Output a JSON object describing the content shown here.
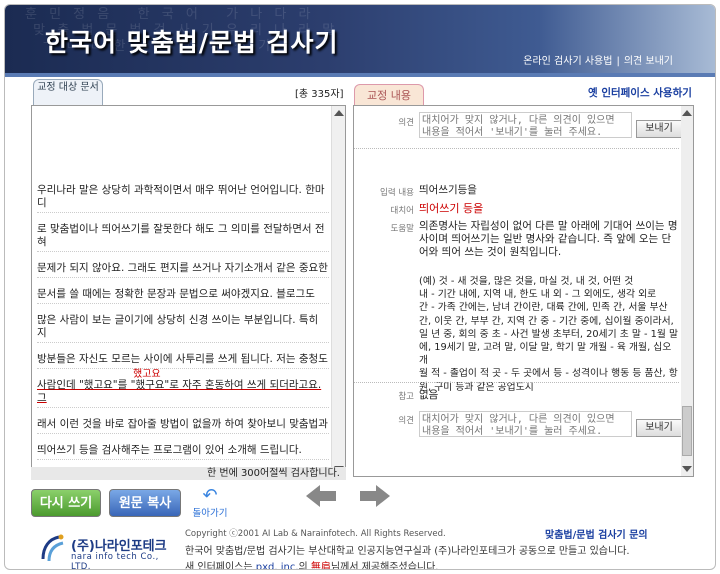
{
  "header": {
    "title": "한국어 맞춤법/문법 검사기",
    "background_text": "훈 민 정 음   한 국 어   가 나 다 라\n 맞 춤 법 문 법 검 사 기 우 리 나 라 말\n  ㄱ ㄴ ㄷ 한 글 바 르 게 쓰 기",
    "link_manual": "온라인 검사기 사용법",
    "link_separator": "|",
    "link_feedback": "의견 보내기"
  },
  "left": {
    "tab_label": "교정 대상 문서",
    "char_count": "[총 335자]",
    "paragraphs": [
      "우리나라 말은 상당히 과학적이면서 매우 뛰어난 언어입니다. 한마디",
      "로 맞춤법이나 띄어쓰기를 잘못한다 해도 그 의미를 전달하면서 전혀",
      "문제가 되지 않아요. 그래도 편지를 쓰거나 자기소개서 같은 중요한",
      "문서를 쓸 때에는 정확한 문장과 문법으로 써야겠지요. 블로그도",
      "많은 사람이 보는 글이기에 상당히 신경 쓰이는 부분입니다. 특히 지",
      "방분들은 자신도 모르는 사이에 사투리를 쓰게 됩니다. 저는 충청도",
      "사람인데 \"했고요\"를 \"했구요\"로 자주 혼동하여 쓰게 되더라고요. 그",
      "래서 이런 것을 바로 잡아줄 방법이 없을까 하여 찾아보니 맞춤법과",
      "띄어쓰기 등을 검사해주는 프로그램이 있어 소개해 드립니다."
    ],
    "suggestion_above": "했고요",
    "footer_text": "한 번에 300어절씩 검사합니다."
  },
  "right": {
    "tab_label": "교정 내용",
    "old_interface_link": "옛 인터페이스 사용하기",
    "opinion_label": "의견",
    "opinion_placeholder": "대치어가 맞지 않거나, 다른 의견이 있으면 내용을 적어서 '보내기'를 눌러 주세요.",
    "send_label": "보내기",
    "input_label": "입력 내용",
    "input_value": "띄어쓰기등을",
    "replace_label": "대치어",
    "replace_value": "띄어쓰기 등을",
    "help_label": "도움말",
    "help_text": "의존명사는 자립성이 없어 다른 말 아래에 기대어 쓰이는 명사이며 띄어쓰기는 일반 명사와 같습니다. 즉 앞에 오는 단어와 띄어 쓰는 것이 원칙입니다.",
    "example_text": "(예) 것 - 새 것을, 많은 것을, 마실 것, 내 것, 어떤 것\n    내 - 기간 내에, 지역 내, 한도 내 외 - 그 외에도, 생각 외로\n간 - 가족 간에는, 남녀 간이란, 대륙 간에, 민족 간, 서울 부산\n간, 이웃 간, 부부 간, 지역 간 중 - 기간 중에, 십이월 중이라서,\n일 년 중, 회의 중 초 - 사건 발생 초부터, 20세기 초 말 - 1월 말\n에, 19세기 말, 고려 말, 이달 말, 학기 말 개월 - 육 개월, 십오 개\n월 적 - 졸업이 적 곳 - 두 곳에서 등 - 성격이나 행동 등 품산, 항\n원, 구미 등과 같은 공업도시",
    "ref_label": "참고",
    "ref_value": "없음"
  },
  "buttons": {
    "again": "다시 쓰기",
    "copy": "원문 복사",
    "back": "돌아가기",
    "prev_icon": "left-arrow-icon",
    "next_icon": "right-arrow-icon"
  },
  "footer": {
    "company": "(주)나라인포테크",
    "company_en": "nara info tech Co., LTD.",
    "copyright": "Copyright ⓒ2001 AI Lab & Narainfotech. All Rights Reserved.",
    "inquiry": "맞춤법/문법 검사기 문의",
    "line1": "한국어 맞춤법/문법 검사기는 부산대학교 인공지능연구실과 (주)나라인포테크가 공동으로 만들고 있습니다.",
    "line2_pre": "새 인터페이스는 ",
    "line2_pxd": "pxd. inc.",
    "line2_mid": "의 ",
    "line2_free": "無肩",
    "line2_post": "님께서 제공해주셨습니다."
  },
  "colors": {
    "header_dark": "#1b2b52",
    "accent_blue": "#1a3fa0",
    "error_red": "#c00000",
    "btn_green": "#4b9a2e",
    "btn_blue": "#3966b8"
  }
}
